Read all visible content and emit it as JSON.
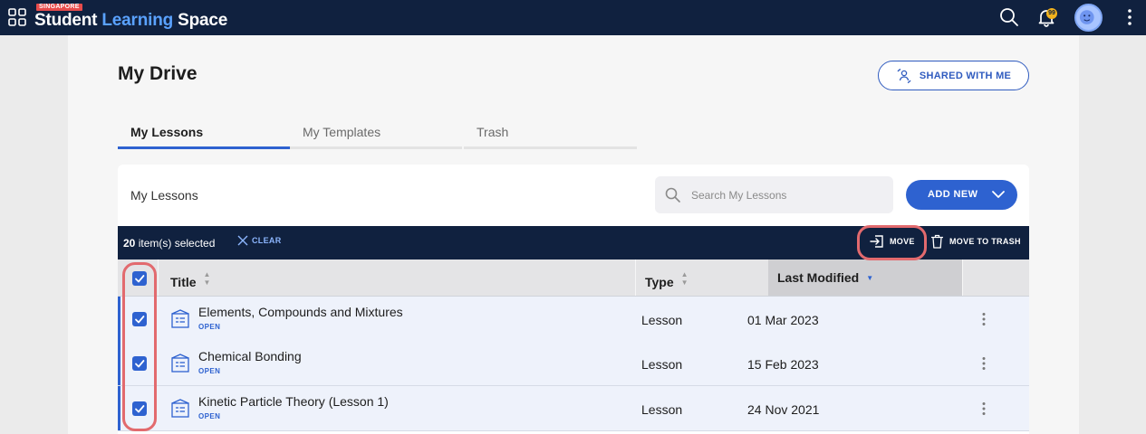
{
  "app": {
    "brand_badge": "SINGAPORE",
    "brand_part1": "Student",
    "brand_part2": "Learning",
    "brand_part3": "Space",
    "notification_count": "99",
    "icons": [
      "apps-grid-icon",
      "search-icon",
      "bell-icon",
      "avatar",
      "more-vertical-icon"
    ]
  },
  "page": {
    "title": "My Drive",
    "shared_with_me_label": "SHARED WITH ME",
    "tabs": [
      {
        "label": "My Lessons",
        "active": true
      },
      {
        "label": "My Templates",
        "active": false
      },
      {
        "label": "Trash",
        "active": false
      }
    ]
  },
  "panel": {
    "title": "My Lessons",
    "search_placeholder": "Search My Lessons",
    "add_new_label": "ADD NEW"
  },
  "selection": {
    "count": "20",
    "suffix": " item(s) selected",
    "clear_label": "CLEAR",
    "move_label": "MOVE",
    "trash_label": "MOVE TO TRASH"
  },
  "table": {
    "columns": {
      "title": "Title",
      "type": "Type",
      "last_modified": "Last Modified"
    },
    "sorted_column": "last_modified",
    "rows": [
      {
        "title": "Elements, Compounds and Mixtures",
        "status": "OPEN",
        "type": "Lesson",
        "date": "01 Mar 2023",
        "checked": true
      },
      {
        "title": "Chemical Bonding",
        "status": "OPEN",
        "type": "Lesson",
        "date": "15 Feb 2023",
        "checked": true
      },
      {
        "title": "Kinetic Particle Theory (Lesson 1)",
        "status": "OPEN",
        "type": "Lesson",
        "date": "24 Nov 2021",
        "checked": true
      }
    ]
  },
  "colors": {
    "navy": "#10213f",
    "accent_blue": "#2e62d0",
    "highlight_red": "#e26a6e"
  }
}
